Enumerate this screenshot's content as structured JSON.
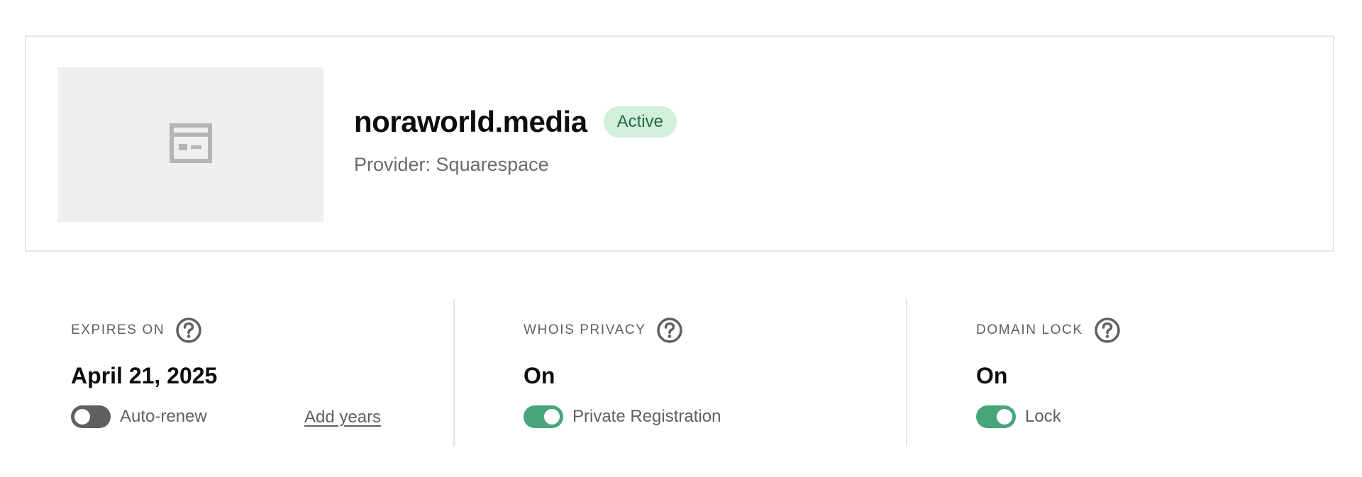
{
  "domain": {
    "name": "noraworld.media",
    "status": "Active",
    "provider": "Provider: Squarespace",
    "thumbnail_icon": "website-placeholder-icon"
  },
  "settings": {
    "expires": {
      "label": "EXPIRES ON",
      "help_icon": "question-circle-icon",
      "value": "April 21, 2025",
      "toggle_label": "Auto-renew",
      "toggle_state": "off",
      "link_label": "Add years"
    },
    "whois": {
      "label": "WHOIS PRIVACY",
      "help_icon": "question-circle-icon",
      "value": "On",
      "toggle_label": "Private Registration",
      "toggle_state": "on"
    },
    "lock": {
      "label": "DOMAIN LOCK",
      "help_icon": "question-circle-icon",
      "value": "On",
      "toggle_label": "Lock",
      "toggle_state": "on"
    }
  },
  "colors": {
    "toggle_on": "#47a578",
    "toggle_off": "#5f5f5f",
    "badge_bg": "#d2eedd",
    "badge_text": "#1f6b43",
    "thumb_bg": "#efefef",
    "icon_gray": "#b5b5b5",
    "help_icon": "#5f5f5f"
  }
}
